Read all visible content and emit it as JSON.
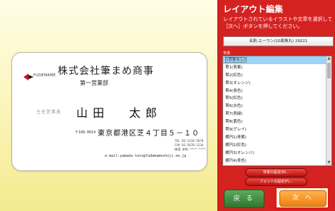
{
  "card": {
    "logo_text": "FUDEMAME",
    "company": "株式会社筆まめ商事",
    "department": "第一営業部",
    "title": "主任営業員",
    "name": "山 田　　太 郎",
    "zip": "〒108-0014",
    "address": "東京都港区芝４丁目５－１０",
    "tel": "TEL 03-1234-5678",
    "fax": "FAX 03-5678-1234",
    "mobile": "携帯 090-****-****",
    "email": "e-mail:yamada-taro@fudemameshoji.ne.jp"
  },
  "panel": {
    "title": "レイアウト編集",
    "instruction": "レイアウトされているイラストや文章を選択して［次へ］ボタンを押してください。",
    "size_label": "名刺:エーワン(10面角丸) 29221",
    "list_label": "背景",
    "list_items": [
      "(背景なし)",
      "帯1(青紫)",
      "帯2(紅色)",
      "帯3(オレンジ)",
      "帯4(青色)",
      "帯5(紅色)",
      "帯6(水色)",
      "帯7(青緑)",
      "帯8(黄色)",
      "帯9(グレイ)",
      "横円1(青紫)",
      "横円2(紅色)",
      "横円3(オレンジ)",
      "横円4(青色)",
      "横円5(紅色)"
    ],
    "bg_settings_button": "背景の設定(B)...",
    "font_settings_button": "フォントの設定(F)...",
    "back_button": "戻 る",
    "next_button": "次 へ"
  },
  "colors": {
    "panel_red": "#d42221",
    "canvas_yellow": "#f6f0a4",
    "next_orange": "#f07e10",
    "back_green": "#3f8a3f",
    "selection_blue": "#9cd4f7"
  }
}
